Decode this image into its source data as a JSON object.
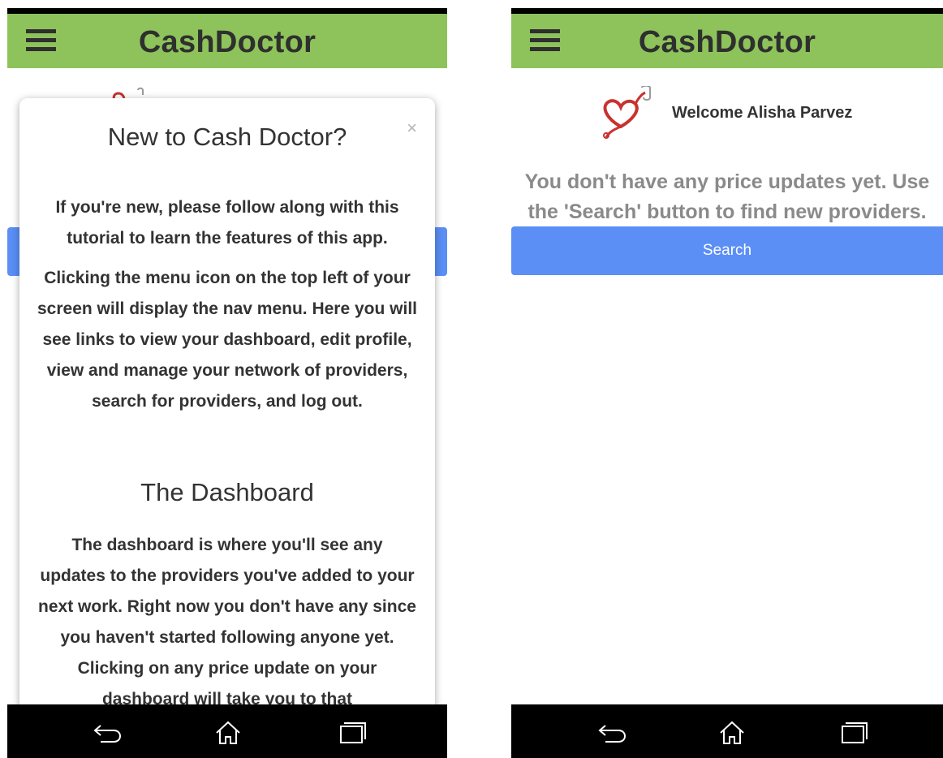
{
  "app": {
    "title": "CashDoctor"
  },
  "left_screen": {
    "modal": {
      "close": "×",
      "title": "New to Cash Doctor?",
      "intro": "If you're new, please follow along with this tutorial to learn the features of this app.",
      "menu_text": "Clicking the menu icon on the top left of your screen will display the nav menu. Here you will see links to view your dashboard, edit profile, view and manage your network of providers, search for providers, and log out.",
      "section_title": "The Dashboard",
      "dashboard_text": "The dashboard is where you'll see any updates to the providers you've added to your next work. Right now you don't have any since you haven't started following anyone yet. Clicking on any price update on your dashboard will take you to that"
    }
  },
  "right_screen": {
    "welcome": "Welcome Alisha Parvez",
    "empty_message": "You don't have any price updates yet. Use the 'Search' button to find new providers.",
    "search_button": "Search"
  },
  "icons": {
    "menu": "hamburger-menu-icon",
    "logo": "heart-stethoscope-logo",
    "back": "back-icon",
    "home": "home-icon",
    "recents": "recent-apps-icon"
  },
  "colors": {
    "appbar": "#8dc35a",
    "button": "#5b8ff6",
    "navbar": "#000000",
    "muted_text": "#8a8a8a"
  }
}
